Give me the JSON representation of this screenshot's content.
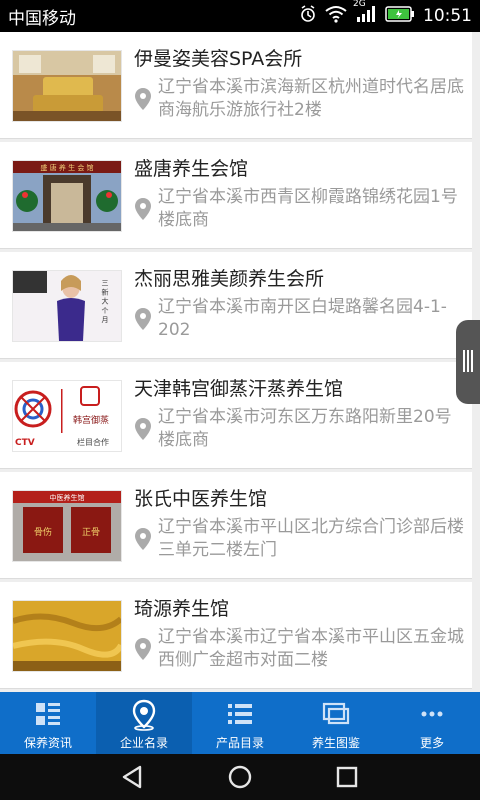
{
  "status_bar": {
    "carrier": "中国移动",
    "network": "2G",
    "time": "10:51"
  },
  "listings": [
    {
      "title": "伊曼姿美容SPA会所",
      "address": "辽宁省本溪市滨海新区杭州道时代名居底商海航乐游旅行社2楼",
      "thumb_icon": "spa-room-photo"
    },
    {
      "title": "盛唐养生会馆",
      "address": "辽宁省本溪市西青区柳霞路锦绣花园1号楼底商",
      "thumb_icon": "storefront-photo"
    },
    {
      "title": "杰丽思雅美颜养生会所",
      "address": "辽宁省本溪市南开区白堤路馨名园4-1-202",
      "thumb_icon": "model-poster-photo"
    },
    {
      "title": "天津韩宫御蒸汗蒸养生馆",
      "address": "辽宁省本溪市河东区万东路阳新里20号楼底商",
      "thumb_icon": "logo-photo"
    },
    {
      "title": "张氏中医养生馆",
      "address": "辽宁省本溪市平山区北方综合门诊部后楼三单元二楼左门",
      "thumb_icon": "clinic-sign-photo"
    },
    {
      "title": "琦源养生馆",
      "address": "辽宁省本溪市辽宁省本溪市平山区五金城西侧广金超市对面二楼",
      "thumb_icon": "gold-fabric-photo"
    }
  ],
  "bottom_nav": [
    {
      "label": "保养资讯",
      "icon": "grid-list-icon",
      "active": false
    },
    {
      "label": "企业名录",
      "icon": "location-pin-icon",
      "active": true
    },
    {
      "label": "产品目录",
      "icon": "list-icon",
      "active": false
    },
    {
      "label": "养生图鉴",
      "icon": "gallery-icon",
      "active": false
    },
    {
      "label": "更多",
      "icon": "more-icon",
      "active": false
    }
  ],
  "thumb_text": {
    "item2_sign": "盛 唐 养 生 会 馆",
    "item3_poster": "三 新 大 个 月",
    "item4_brand": "韩宫御蒸",
    "item4_ctv": "CTV",
    "item4_tail": "栏目合作",
    "item5_sign": "中医养生馆",
    "item5_left": "骨伤",
    "item5_right": "正骨"
  },
  "colors": {
    "nav_bg": "#0f6ec9",
    "title": "#222222",
    "address": "#9a9a9a",
    "status_bg": "#000000"
  }
}
